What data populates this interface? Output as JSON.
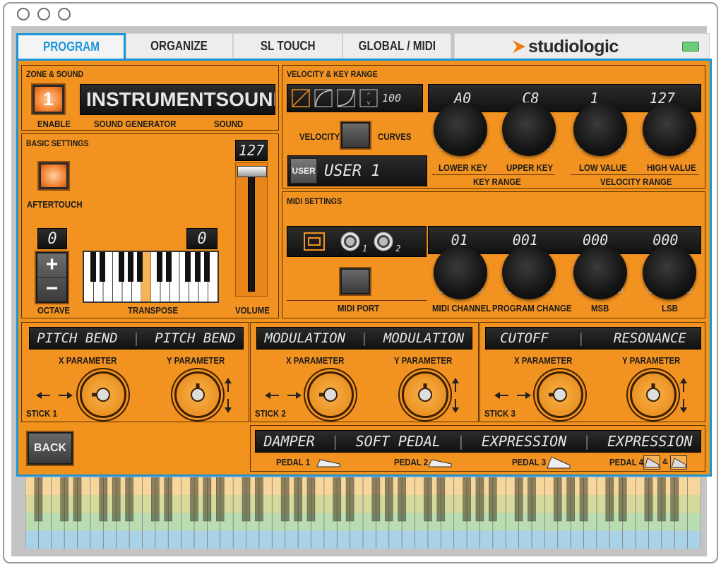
{
  "tabs": [
    {
      "label": "PROGRAM"
    },
    {
      "label": "ORGANIZE"
    },
    {
      "label": "SL TOUCH"
    },
    {
      "label": "GLOBAL / MIDI"
    }
  ],
  "brand": "studiologic",
  "zone": {
    "title": "ZONE & SOUND",
    "number": "1",
    "enable": "ENABLE",
    "instrument": "INSTRUMENT",
    "sound": "SOUND",
    "sound_generator_label": "SOUND GENERATOR",
    "sound_label": "SOUND"
  },
  "velocity": {
    "title": "VELOCITY & KEY RANGE",
    "curve_value": "100",
    "velocity_label": "VELOCITY",
    "curves_label": "CURVES",
    "user_btn": "USER",
    "user_value": "USER 1"
  },
  "keyrange": {
    "lower": "A0",
    "upper": "C8",
    "low_value": "1",
    "high_value": "127",
    "lower_label": "LOWER KEY",
    "upper_label": "UPPER KEY",
    "low_label": "LOW VALUE",
    "high_label": "HIGH VALUE",
    "key_range_label": "KEY RANGE",
    "velocity_range_label": "VELOCITY RANGE"
  },
  "basic": {
    "title": "BASIC SETTINGS",
    "aftertouch": "AFTERTOUCH",
    "octave_value": "0",
    "transpose_value": "0",
    "volume_value": "127",
    "octave_label": "OCTAVE",
    "transpose_label": "TRANSPOSE",
    "volume_label": "VOLUME",
    "plus": "+",
    "minus": "−"
  },
  "midi": {
    "title": "MIDI SETTINGS",
    "port1": "1",
    "port2": "2",
    "channel": "01",
    "program": "001",
    "msb": "000",
    "lsb": "000",
    "port_label": "MIDI PORT",
    "channel_label": "MIDI CHANNEL",
    "program_label": "PROGRAM CHANGE",
    "msb_label": "MSB",
    "lsb_label": "LSB"
  },
  "sticks": [
    {
      "x": "PITCH BEND",
      "y": "PITCH BEND",
      "label": "STICK 1"
    },
    {
      "x": "MODULATION",
      "y": "MODULATION",
      "label": "STICK 2"
    },
    {
      "x": "CUTOFF",
      "y": "RESONANCE",
      "label": "STICK 3"
    }
  ],
  "stick_x_label": "X PARAMETER",
  "stick_y_label": "Y PARAMETER",
  "pedals": [
    {
      "name": "DAMPER",
      "label": "PEDAL 1"
    },
    {
      "name": "SOFT PEDAL",
      "label": "PEDAL 2"
    },
    {
      "name": "EXPRESSION",
      "label": "PEDAL 3"
    },
    {
      "name": "EXPRESSION",
      "label": "PEDAL 4"
    }
  ],
  "pedal4_amp": "&",
  "back": "BACK",
  "colors": {
    "accent": "#1a95d8",
    "panel": "#f29220",
    "lcd": "#1a1a1a"
  }
}
